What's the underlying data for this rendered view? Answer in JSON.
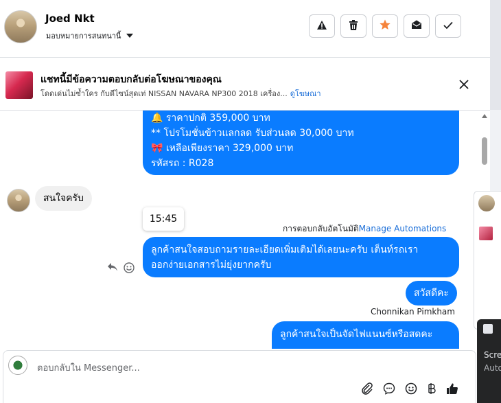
{
  "header": {
    "contact_name": "Joed Nkt",
    "assign_label": "มอบหมายการสนทนานี้",
    "actions": [
      "spam",
      "delete",
      "star",
      "mark-unread",
      "done"
    ]
  },
  "ad_banner": {
    "title": "แชทนี้มีข้อความตอบกลับต่อโฆษณาของคุณ",
    "subtitle": "โดดเด่นไม่ซ้ำใคร กับดีไซน์สุดเท่ NISSAN NAVARA NP300 2018 เครื่อง...",
    "link": "ดูโฆษณา"
  },
  "messages": {
    "offer_lines": [
      "🔔 ราคาปกติ 359,000 บาท",
      "** โปรโมชั่นข้าวแลกลด รับส่วนลด 30,000 บาท",
      "🎀  เหลือเพียงราคา 329,000 บาท",
      " รหัสรถ : R028"
    ],
    "incoming": "สนใจครับ",
    "time": "15:45",
    "auto_reply_label": "การตอบกลับอัตโนมัติ",
    "auto_reply_link": "Manage Automations",
    "auto_reply_lines": [
      "ลูกค้าสนใจสอบถามรายละเอียดเพิ่มเติมได้เลยนะครับ เต็นท์รถเรา",
      "ออกง่ายเอกสารไม่ยุ่งยากครับ"
    ],
    "greeting": "สวัสดีคะ",
    "sender_name": "Chonnikan Pimkham",
    "last_message": "ลูกค้าสนใจเป็นจัดไฟแนนซ์หรือสดคะ"
  },
  "composer": {
    "placeholder": "ตอบกลับใน Messenger..."
  },
  "side_panel": {
    "line1": "Scre",
    "line2": "Auto"
  },
  "colors": {
    "accent": "#0a7cff",
    "star": "#f5833b"
  }
}
